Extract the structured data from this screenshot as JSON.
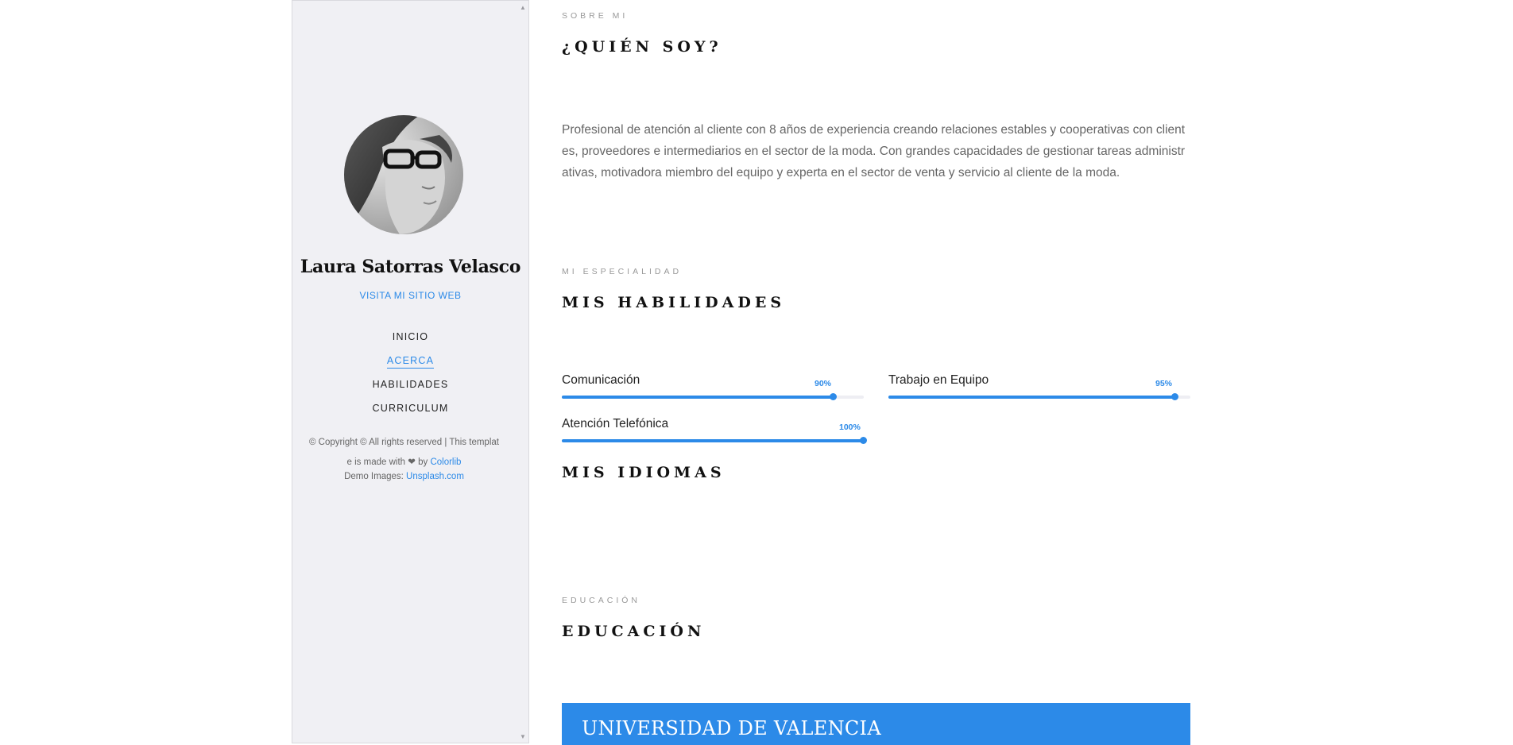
{
  "sidebar": {
    "name": "Laura Satorras Velasco",
    "site_link": "VISITA MI SITIO WEB",
    "nav": [
      {
        "label": "INICIO",
        "active": false
      },
      {
        "label": "ACERCA",
        "active": true
      },
      {
        "label": "HABILIDADES",
        "active": false
      },
      {
        "label": "CURRICULUM",
        "active": false
      }
    ],
    "footer": {
      "copyright": "© Copyright © All rights reserved | This template is made with",
      "heart_icon": "heart-icon",
      "by": "by",
      "colorlib": "Colorlib",
      "demo_images_label": "Demo Images:",
      "unsplash": "Unsplash.com"
    }
  },
  "about": {
    "eyebrow": "SOBRE MI",
    "title": "¿QUIÉN SOY?",
    "body": "Profesional de atención al cliente con 8 años de experiencia creando relaciones estables y cooperativas con clientes, proveedores e intermediarios en el sector de la moda. Con grandes capacidades de gestionar tareas administrativas, motivadora miembro del equipo y experta en el sector de venta y servicio al cliente de la moda."
  },
  "skills": {
    "eyebrow": "MI ESPECIALIDAD",
    "title": "MIS HABILIDADES",
    "items": [
      {
        "label": "Comunicación",
        "percent_label": "90%",
        "percent": 90
      },
      {
        "label": "Trabajo en Equipo",
        "percent_label": "95%",
        "percent": 95
      },
      {
        "label": "Atención Telefónica",
        "percent_label": "100%",
        "percent": 100
      }
    ]
  },
  "languages": {
    "title": "MIS IDIOMAS"
  },
  "education": {
    "eyebrow": "EDUCACIÓN",
    "title": "EDUCACIÓN",
    "card_title": "UNIVERSIDAD DE VALENCIA"
  },
  "colors": {
    "accent": "#2c8ae8",
    "sidebar_bg": "#f0f0f4",
    "heading": "#111111",
    "body_text": "#666666"
  }
}
